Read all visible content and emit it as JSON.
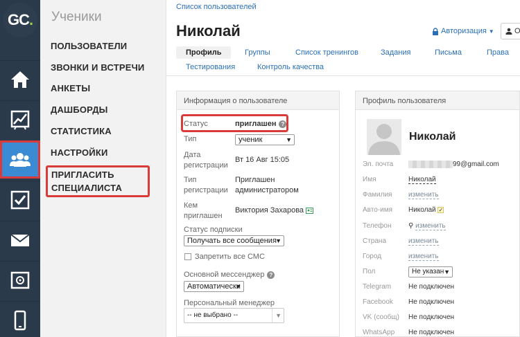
{
  "logo": {
    "letters": "GC",
    "dot": "."
  },
  "rail": {
    "items": [
      {
        "name": "home-icon"
      },
      {
        "name": "chart-icon"
      },
      {
        "name": "users-icon",
        "active": true
      },
      {
        "name": "checkbox-icon"
      },
      {
        "name": "mail-icon"
      },
      {
        "name": "safe-icon"
      },
      {
        "name": "phone-icon"
      }
    ]
  },
  "menu": {
    "title": "Ученики",
    "items": [
      "ПОЛЬЗОВАТЕЛИ",
      "ЗВОНКИ И ВСТРЕЧИ",
      "АНКЕТЫ",
      "ДАШБОРДЫ",
      "СТАТИСТИКА",
      "НАСТРОЙКИ"
    ],
    "invite_line1": "ПРИГЛАСИТЬ",
    "invite_line2": "СПЕЦИАЛИСТА"
  },
  "header": {
    "breadcrumb": "Список пользователей",
    "user_name": "Николай",
    "auth_label": "Авторизация",
    "other_label": "От"
  },
  "tabs": [
    "Профиль",
    "Группы",
    "Список тренингов",
    "Задания",
    "Письма",
    "Права",
    "Тестирования",
    "Контроль качества"
  ],
  "info": {
    "title": "Информация о пользователе",
    "status_label": "Статус",
    "status_value": "приглашен",
    "type_label": "Тип",
    "type_value": "ученик",
    "reg_date_label1": "Дата",
    "reg_date_label2": "регистрации",
    "reg_date_value": "Вт 16 Авг 15:05",
    "reg_type_label1": "Тип",
    "reg_type_label2": "регистрации",
    "reg_type_value1": "Приглашен",
    "reg_type_value2": "администратором",
    "invited_by_label1": "Кем",
    "invited_by_label2": "приглашен",
    "invited_by_value": "Виктория Захарова",
    "subscription_label": "Статус подписки",
    "subscription_value": "Получать все сообщения",
    "sms_label": "Запретить все СМС",
    "messenger_label": "Основной мессенджер",
    "messenger_value": "Автоматически",
    "manager_label": "Персональный менеджер",
    "manager_value": "-- не выбрано --"
  },
  "profile": {
    "title": "Профиль пользователя",
    "name": "Николай",
    "email_label": "Эл. почта",
    "email_value": "99@gmail.com",
    "first_name_label": "Имя",
    "first_name_value": "Николай",
    "last_name_label": "Фамилия",
    "last_name_value": "изменить",
    "auto_name_label": "Авто-имя",
    "auto_name_value": "Николай",
    "phone_label": "Телефон",
    "phone_value": "изменить",
    "country_label": "Страна",
    "country_value": "изменить",
    "city_label": "Город",
    "city_value": "изменить",
    "gender_label": "Пол",
    "gender_value": "Не указан",
    "telegram_label": "Telegram",
    "telegram_value": "Не подключен",
    "facebook_label": "Facebook",
    "facebook_value": "Не подключен",
    "vk_label": "VK (сообщ)",
    "vk_value": "Не подключен",
    "whatsapp_label": "WhatsApp",
    "whatsapp_value": "Не подключен"
  }
}
